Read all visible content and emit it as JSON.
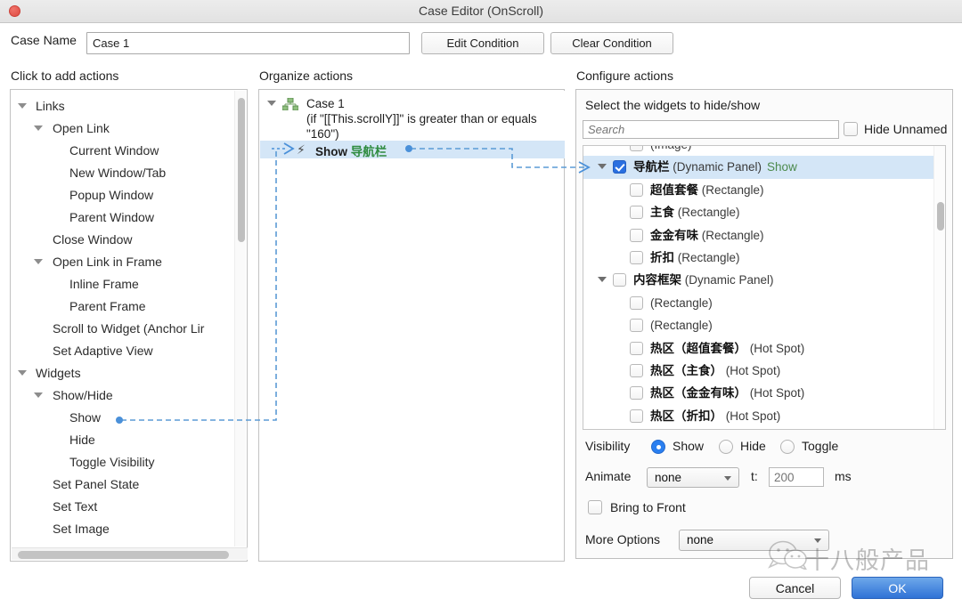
{
  "window": {
    "title": "Case Editor (OnScroll)",
    "close_icon": "close-circle-icon"
  },
  "case_row": {
    "label": "Case Name",
    "value": "Case 1",
    "placeholder": "",
    "edit_condition": "Edit Condition",
    "clear_condition": "Clear Condition"
  },
  "columns": {
    "left": "Click to add actions",
    "middle": "Organize actions",
    "right": "Configure actions"
  },
  "action_tree": [
    {
      "label": "Links",
      "indent": 0,
      "caret": true
    },
    {
      "label": "Open Link",
      "indent": 1,
      "caret": true
    },
    {
      "label": "Current Window",
      "indent": 2,
      "caret": false
    },
    {
      "label": "New Window/Tab",
      "indent": 2,
      "caret": false
    },
    {
      "label": "Popup Window",
      "indent": 2,
      "caret": false
    },
    {
      "label": "Parent Window",
      "indent": 2,
      "caret": false
    },
    {
      "label": "Close Window",
      "indent": 1,
      "caret": false
    },
    {
      "label": "Open Link in Frame",
      "indent": 1,
      "caret": true
    },
    {
      "label": "Inline Frame",
      "indent": 2,
      "caret": false
    },
    {
      "label": "Parent Frame",
      "indent": 2,
      "caret": false
    },
    {
      "label": "Scroll to Widget (Anchor Lir",
      "indent": 1,
      "caret": false
    },
    {
      "label": "Set Adaptive View",
      "indent": 1,
      "caret": false
    },
    {
      "label": "Widgets",
      "indent": 0,
      "caret": true
    },
    {
      "label": "Show/Hide",
      "indent": 1,
      "caret": true
    },
    {
      "label": "Show",
      "indent": 2,
      "caret": false,
      "linked": true
    },
    {
      "label": "Hide",
      "indent": 2,
      "caret": false
    },
    {
      "label": "Toggle Visibility",
      "indent": 2,
      "caret": false
    },
    {
      "label": "Set Panel State",
      "indent": 1,
      "caret": false
    },
    {
      "label": "Set Text",
      "indent": 1,
      "caret": false
    },
    {
      "label": "Set Image",
      "indent": 1,
      "caret": false
    }
  ],
  "organize": {
    "case_title": "Case 1",
    "case_condition": "(if \"[[This.scrollY]]\" is greater than or equals \"160\")",
    "action_verb": "Show",
    "action_target": "导航栏"
  },
  "configure": {
    "heading": "Select the widgets to hide/show",
    "search_placeholder": "Search",
    "search_value": "",
    "hide_unnamed_label": "Hide Unnamed",
    "hide_unnamed_checked": false,
    "widgets": [
      {
        "name": "",
        "type": "(Image)",
        "indent": 1,
        "caret": false,
        "checked": false,
        "selected": false,
        "status": ""
      },
      {
        "name": "导航栏",
        "type": "(Dynamic Panel)",
        "indent": 0,
        "caret": true,
        "checked": true,
        "selected": true,
        "status": "Show"
      },
      {
        "name": "超值套餐",
        "type": "(Rectangle)",
        "indent": 1,
        "caret": false,
        "checked": false,
        "selected": false,
        "status": ""
      },
      {
        "name": "主食",
        "type": "(Rectangle)",
        "indent": 1,
        "caret": false,
        "checked": false,
        "selected": false,
        "status": ""
      },
      {
        "name": "金金有味",
        "type": "(Rectangle)",
        "indent": 1,
        "caret": false,
        "checked": false,
        "selected": false,
        "status": ""
      },
      {
        "name": "折扣",
        "type": "(Rectangle)",
        "indent": 1,
        "caret": false,
        "checked": false,
        "selected": false,
        "status": ""
      },
      {
        "name": "内容框架",
        "type": "(Dynamic Panel)",
        "indent": 0,
        "caret": true,
        "checked": false,
        "selected": false,
        "status": ""
      },
      {
        "name": "",
        "type": "(Rectangle)",
        "indent": 1,
        "caret": false,
        "checked": false,
        "selected": false,
        "status": ""
      },
      {
        "name": "",
        "type": "(Rectangle)",
        "indent": 1,
        "caret": false,
        "checked": false,
        "selected": false,
        "status": ""
      },
      {
        "name": "热区（超值套餐）",
        "type": "(Hot Spot)",
        "indent": 1,
        "caret": false,
        "checked": false,
        "selected": false,
        "status": ""
      },
      {
        "name": "热区（主食）",
        "type": "(Hot Spot)",
        "indent": 1,
        "caret": false,
        "checked": false,
        "selected": false,
        "status": ""
      },
      {
        "name": "热区（金金有味）",
        "type": "(Hot Spot)",
        "indent": 1,
        "caret": false,
        "checked": false,
        "selected": false,
        "status": ""
      },
      {
        "name": "热区（折扣）",
        "type": "(Hot Spot)",
        "indent": 1,
        "caret": false,
        "checked": false,
        "selected": false,
        "status": ""
      }
    ],
    "visibility": {
      "label": "Visibility",
      "options": [
        "Show",
        "Hide",
        "Toggle"
      ],
      "selected": "Show"
    },
    "animate": {
      "label": "Animate",
      "value": "none",
      "time_label": "t:",
      "time_value": "",
      "time_placeholder": "200",
      "unit": "ms"
    },
    "bring_to_front": {
      "label": "Bring to Front",
      "checked": false
    },
    "more_options": {
      "label": "More Options",
      "value": "none"
    }
  },
  "footer": {
    "cancel": "Cancel",
    "ok": "OK"
  },
  "watermark": {
    "text": "十八般产品",
    "icon": "wechat-logo-icon"
  },
  "colors": {
    "selection_blue": "#d4e6f7",
    "connector_blue": "#5b9bd5",
    "accent_checkbox": "#2a6fe0",
    "ok_button": "#2f72d6",
    "show_green": "#4c8a4c",
    "target_green": "#2e8b3f"
  }
}
